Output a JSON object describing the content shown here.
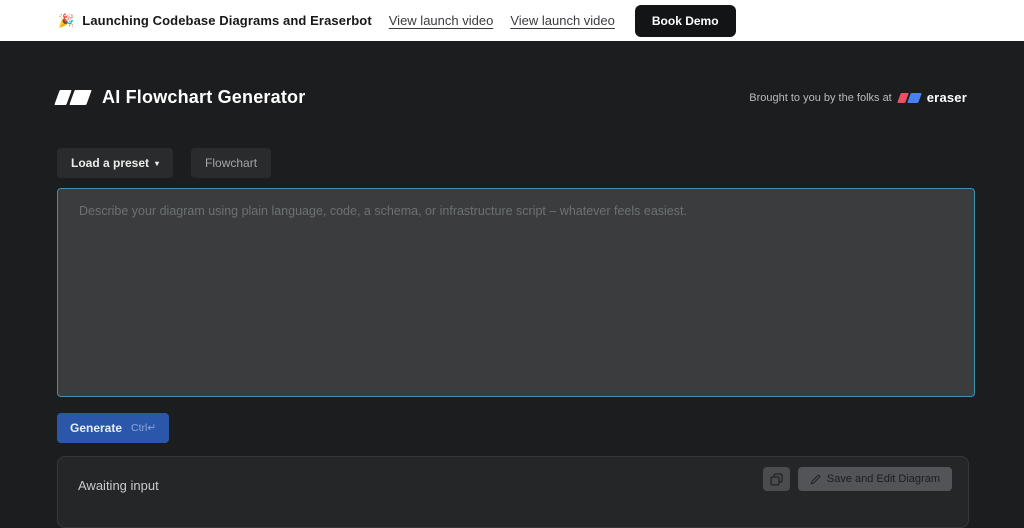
{
  "banner": {
    "emoji": "🎉",
    "title": "Launching Codebase Diagrams and Eraserbot",
    "links": [
      {
        "label": "View launch video"
      },
      {
        "label": "View launch video"
      }
    ],
    "cta": "Book Demo"
  },
  "header": {
    "title": "AI Flowchart Generator",
    "attribution": "Brought to you by the folks at",
    "brand": "eraser"
  },
  "toolbar": {
    "preset_button": "Load a preset",
    "preset_caret": "▾",
    "diagram_type": "Flowchart"
  },
  "editor": {
    "value": "",
    "placeholder": "Describe your diagram using plain language, code, a schema, or infrastructure script – whatever feels easiest."
  },
  "generate": {
    "label": "Generate",
    "shortcut": "Ctrl↵"
  },
  "output": {
    "status": "Awaiting input",
    "copy_icon": "copy-icon",
    "save_button": "Save and Edit Diagram"
  },
  "colors": {
    "banner_bg": "#ffffff",
    "page_bg": "#1c1d1e",
    "cta_bg": "#131416",
    "accent_blue": "#2a57a9",
    "editor_border_teal": "#3d92ae",
    "logo_red": "#ec5063",
    "logo_blue": "#4a80f5"
  }
}
